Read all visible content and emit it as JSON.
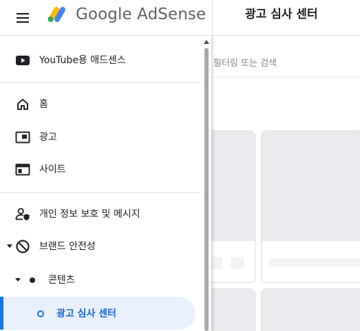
{
  "header": {
    "brand_google": "Google",
    "brand_product": "AdSense",
    "page_title": "광고 심사 센터"
  },
  "filter": {
    "placeholder": "필터링 또는 검색"
  },
  "sidebar": {
    "items": [
      {
        "label": "YouTube용 애드센스",
        "icon": "youtube-icon"
      },
      {
        "label": "홈",
        "icon": "home-icon"
      },
      {
        "label": "광고",
        "icon": "ads-icon"
      },
      {
        "label": "사이트",
        "icon": "sites-icon"
      },
      {
        "label": "개인 정보 보호 및 메시지",
        "icon": "privacy-person-icon"
      },
      {
        "label": "브랜드 안전성",
        "icon": "block-icon"
      },
      {
        "label": "콘텐츠",
        "icon": "dot-icon"
      },
      {
        "label": "광고 심사 센터",
        "icon": "circle-outline-icon",
        "active": true
      }
    ]
  },
  "colors": {
    "accent": "#1a73e8",
    "active_bg": "#e8f0fe",
    "google_blue": "#4285f4",
    "google_yellow": "#fbbc04",
    "google_green": "#34a853"
  }
}
